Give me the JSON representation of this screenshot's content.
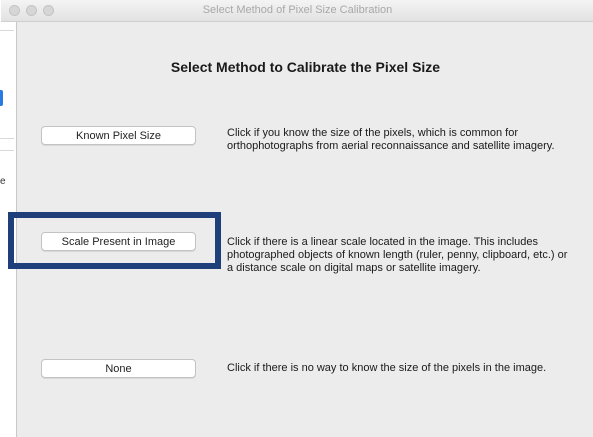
{
  "window": {
    "title": "Select Method of Pixel Size Calibration"
  },
  "dialog": {
    "heading": "Select Method to Calibrate the Pixel Size",
    "options": [
      {
        "label": "Known Pixel Size",
        "description": "Click if you know the size of the pixels, which is common for orthophotographs from aerial reconnaissance and satellite imagery."
      },
      {
        "label": "Scale Present in Image",
        "description": "Click if there is a linear scale located in the image.  This includes photographed objects of known length (ruler, penny, clipboard, etc.) or a distance scale on digital maps or satellite imagery."
      },
      {
        "label": "None",
        "description": "Click if there is no way to know the size of the pixels in the image."
      }
    ]
  },
  "background": {
    "glyph": "e"
  },
  "colors": {
    "highlight_border": "#1f3f7a",
    "focus_accent": "#2a7ae2",
    "dialog_background": "#ececec"
  },
  "icons": {
    "close": "close-button-icon",
    "minimize": "minimize-button-icon",
    "zoom": "zoom-button-icon"
  }
}
